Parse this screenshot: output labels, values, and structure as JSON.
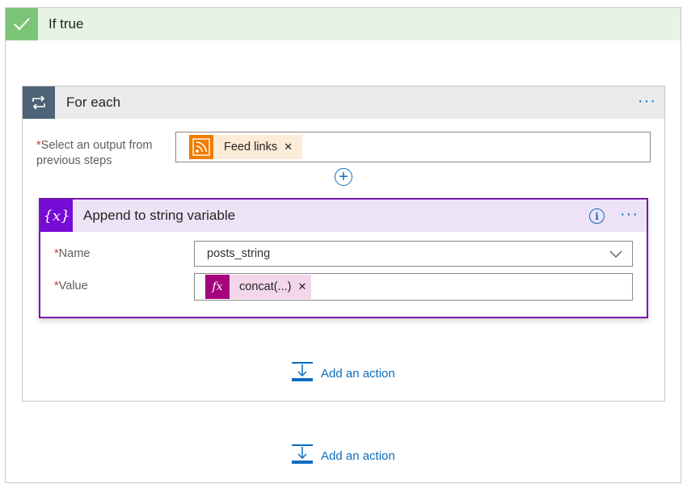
{
  "if_true": {
    "title": "If true"
  },
  "for_each": {
    "title": "For each",
    "select_label": "Select an output from previous steps",
    "select_token": "Feed links"
  },
  "append": {
    "title": "Append to string variable",
    "name_label": "Name",
    "name_value": "posts_string",
    "value_label": "Value",
    "value_token": "concat(...)"
  },
  "actions": {
    "add_action_label": "Add an action"
  },
  "colors": {
    "if_true_accent": "#7cc576",
    "for_each_accent": "#4e6377",
    "variable_accent": "#770bd6",
    "rss_token": "#f07c00",
    "expression_token": "#a5037c",
    "link": "#0f6cbd"
  },
  "icons": [
    "check-icon",
    "loop-icon",
    "more-options-icon",
    "rss-icon",
    "remove-icon",
    "add-icon",
    "variable-icon",
    "info-icon",
    "chevron-down-icon",
    "expression-icon",
    "add-action-icon"
  ]
}
